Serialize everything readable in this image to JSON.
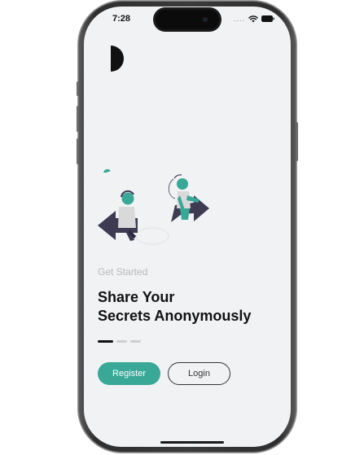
{
  "status_bar": {
    "time": "7:28",
    "signal": "....",
    "icons": [
      "wifi-icon",
      "battery-icon"
    ]
  },
  "onboarding": {
    "eyebrow": "Get Started",
    "headline_line1": "Share Your",
    "headline_line2": "Secrets Anonymously",
    "pager": {
      "total": 3,
      "active_index": 0
    }
  },
  "actions": {
    "register_label": "Register",
    "login_label": "Login"
  },
  "colors": {
    "accent": "#3aa897",
    "background": "#f1f2f4",
    "text_primary": "#111111",
    "text_muted": "#b8b8b8",
    "arrow_dark": "#3d3a52"
  }
}
